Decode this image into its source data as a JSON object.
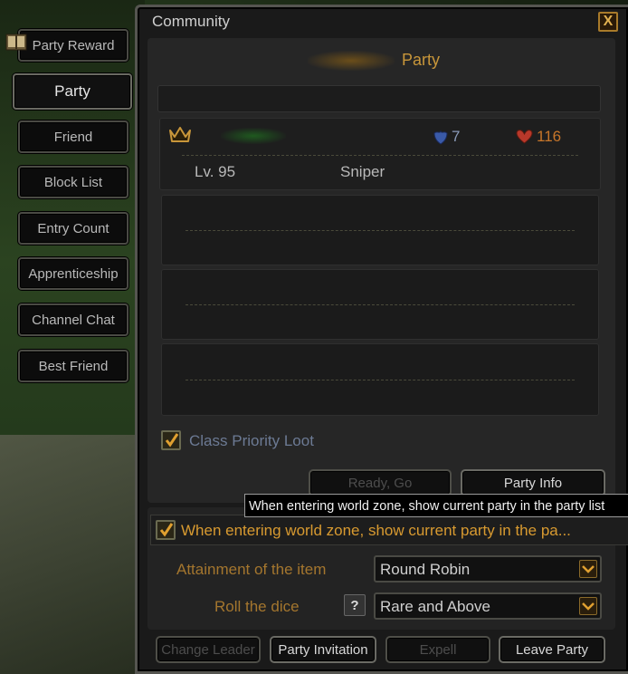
{
  "window": {
    "title": "Community",
    "close_label": "X"
  },
  "side_tabs": [
    {
      "label": "Party Reward"
    },
    {
      "label": "Party",
      "active": true
    },
    {
      "label": "Friend"
    },
    {
      "label": "Block List"
    },
    {
      "label": "Entry Count"
    },
    {
      "label": "Apprenticeship"
    },
    {
      "label": "Channel Chat"
    },
    {
      "label": "Best Friend"
    }
  ],
  "party": {
    "title": "Party",
    "member": {
      "icon": "crown-icon",
      "defense": "7",
      "hp": "116",
      "level": "Lv. 95",
      "class": "Sniper"
    },
    "class_priority_loot": {
      "label": "Class Priority Loot",
      "checked": true
    }
  },
  "buttons": {
    "ready_go": "Ready, Go",
    "party_info": "Party Info",
    "change_leader": "Change Leader",
    "party_invitation": "Party Invitation",
    "expell": "Expell",
    "leave_party": "Leave Party"
  },
  "tooltip": "When entering world zone, show current party in the party list",
  "world_zone_option": {
    "label": "When entering world zone, show current party in the pa...",
    "checked": true
  },
  "settings": {
    "attainment_label": "Attainment of the item",
    "attainment_value": "Round Robin",
    "roll_label": "Roll the dice",
    "roll_help": "?",
    "roll_value": "Rare and Above"
  },
  "colors": {
    "accent_gold": "#c8963a",
    "tooltip_bg": "#000000",
    "shield_blue": "#3a5aa8",
    "heart_red": "#b8382a"
  }
}
